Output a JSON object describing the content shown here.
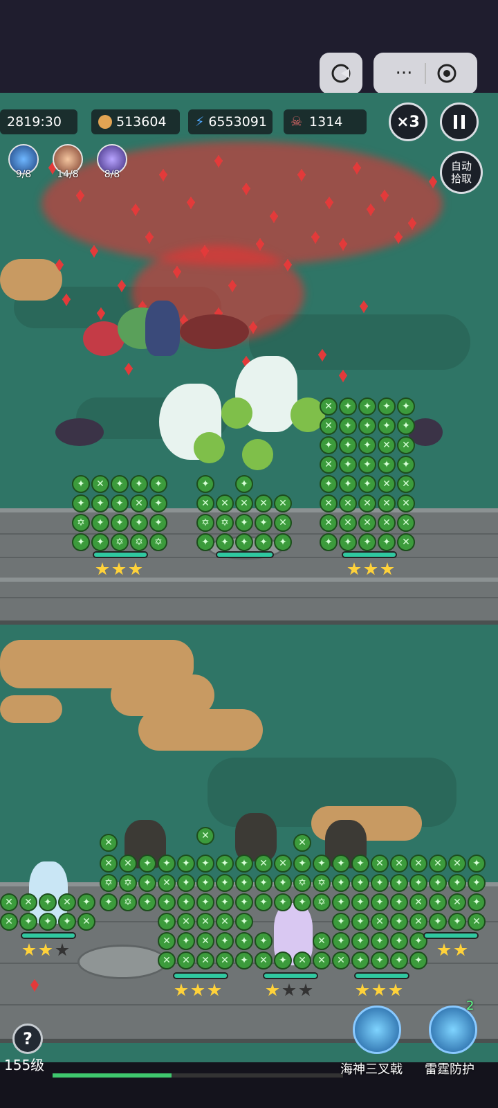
{
  "hud": {
    "timer": "2819:30",
    "coins": "513604",
    "damage": "6553091",
    "kills": "1314",
    "speed_label": "×3"
  },
  "skills": [
    {
      "icon": "trident-skill-icon",
      "count": "9/8"
    },
    {
      "icon": "spiral-skill-icon",
      "count": "14/8"
    },
    {
      "icon": "wolf-skill-icon",
      "count": "8/8"
    }
  ],
  "auto_pickup_label": "自动拾取",
  "player": {
    "level_label": "155级",
    "xp_progress": 0.41
  },
  "ultimates": [
    {
      "label": "海神三叉戟",
      "charges": ""
    },
    {
      "label": "雷霆防护",
      "charges": "2"
    }
  ],
  "help_label": "?",
  "towers": {
    "upper_stars": [
      3,
      3,
      3
    ],
    "lower_stars": [
      2,
      3,
      1,
      3,
      2
    ]
  },
  "colors": {
    "field": "#2f7566",
    "crystal": "#e33a3a",
    "hp": "#30c8a0",
    "xp": "#3fc86e",
    "star": "#ffd23a"
  }
}
